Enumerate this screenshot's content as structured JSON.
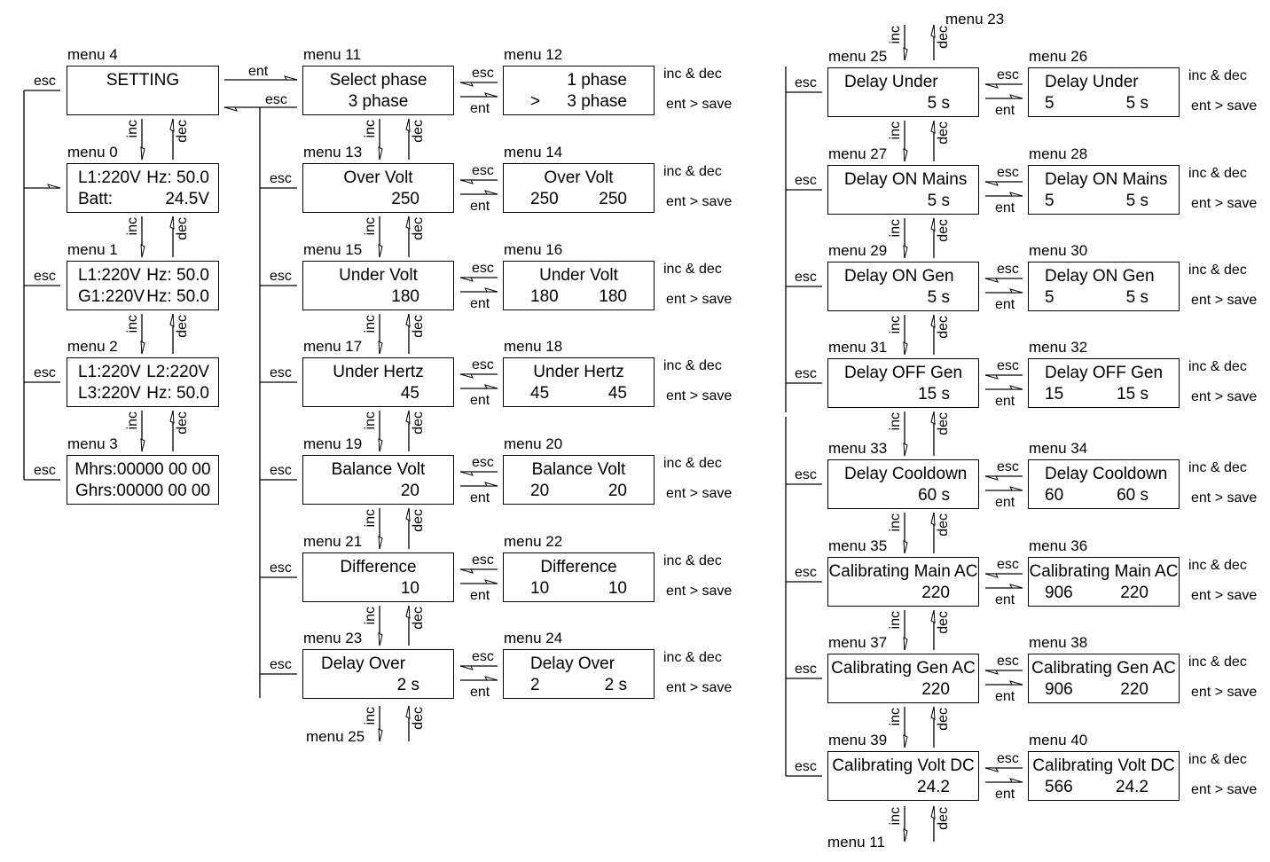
{
  "labels": {
    "esc": "esc",
    "ent": "ent",
    "inc": "inc",
    "dec": "dec",
    "note_adjust": "inc & dec",
    "note_save": "ent > save"
  },
  "columns": {
    "status": [
      {
        "title": "menu 4",
        "rows": [
          {
            "c": "SETTING"
          }
        ]
      },
      {
        "title": "menu 0",
        "rows": [
          {
            "l": "L1:220V",
            "r": "Hz: 50.0"
          },
          {
            "l": "Batt:",
            "r": "24.5V"
          }
        ]
      },
      {
        "title": "menu 1",
        "rows": [
          {
            "l": "L1:220V",
            "r": "Hz: 50.0"
          },
          {
            "l": "G1:220V",
            "r": "Hz: 50.0"
          }
        ]
      },
      {
        "title": "menu 2",
        "rows": [
          {
            "l": "L1:220V",
            "r": "L2:220V"
          },
          {
            "l": "L3:220V",
            "r": "Hz: 50.0"
          }
        ]
      },
      {
        "title": "menu 3",
        "rows": [
          {
            "c": "Mhrs:00000 00 00"
          },
          {
            "c": "Ghrs:00000 00 00"
          }
        ]
      }
    ],
    "settings_a": [
      {
        "title": "menu 11",
        "rows": [
          {
            "c": "Select phase"
          },
          {
            "c": "3 phase"
          }
        ]
      },
      {
        "title": "menu 13",
        "rows": [
          {
            "c": "Over Volt"
          },
          {
            "r": "250"
          }
        ]
      },
      {
        "title": "menu 15",
        "rows": [
          {
            "c": "Under Volt"
          },
          {
            "r": "180"
          }
        ]
      },
      {
        "title": "menu 17",
        "rows": [
          {
            "c": "Under Hertz"
          },
          {
            "r": "45"
          }
        ]
      },
      {
        "title": "menu 19",
        "rows": [
          {
            "c": "Balance Volt"
          },
          {
            "r": "20"
          }
        ]
      },
      {
        "title": "menu 21",
        "rows": [
          {
            "c": "Difference"
          },
          {
            "r": "10"
          }
        ]
      },
      {
        "title": "menu 23",
        "rows": [
          {
            "l": "Delay Over"
          },
          {
            "r": "2 s"
          }
        ]
      }
    ],
    "edit_a": [
      {
        "title": "menu 12",
        "rows": [
          {
            "r": "1 phase"
          },
          {
            "l": ">",
            "r": "3 phase"
          }
        ]
      },
      {
        "title": "menu 14",
        "rows": [
          {
            "c": "Over Volt"
          },
          {
            "l": "250",
            "r": "250"
          }
        ]
      },
      {
        "title": "menu 16",
        "rows": [
          {
            "c": "Under Volt"
          },
          {
            "l": "180",
            "r": "180"
          }
        ]
      },
      {
        "title": "menu 18",
        "rows": [
          {
            "c": "Under Hertz"
          },
          {
            "l": "45",
            "r": "45"
          }
        ]
      },
      {
        "title": "menu 20",
        "rows": [
          {
            "c": "Balance Volt"
          },
          {
            "l": "20",
            "r": "20"
          }
        ]
      },
      {
        "title": "menu 22",
        "rows": [
          {
            "c": "Difference"
          },
          {
            "l": "10",
            "r": "10"
          }
        ]
      },
      {
        "title": "menu 24",
        "rows": [
          {
            "l": "Delay Over"
          },
          {
            "l": "2",
            "r": "2 s"
          }
        ]
      }
    ],
    "settings_b": [
      {
        "title": "menu 25",
        "rows": [
          {
            "l": "Delay Under"
          },
          {
            "r": "5 s"
          }
        ]
      },
      {
        "title": "menu 27",
        "rows": [
          {
            "l": "Delay ON Mains"
          },
          {
            "r": "5 s"
          }
        ]
      },
      {
        "title": "menu 29",
        "rows": [
          {
            "l": "Delay ON Gen"
          },
          {
            "r": "5 s"
          }
        ]
      },
      {
        "title": "menu 31",
        "rows": [
          {
            "l": "Delay OFF Gen"
          },
          {
            "r": "15 s"
          }
        ]
      },
      {
        "title": "menu 33",
        "rows": [
          {
            "l": "Delay Cooldown"
          },
          {
            "r": "60 s"
          }
        ]
      },
      {
        "title": "menu 35",
        "rows": [
          {
            "c": "Calibrating Main AC"
          },
          {
            "r": "220"
          }
        ]
      },
      {
        "title": "menu 37",
        "rows": [
          {
            "c": "Calibrating Gen AC"
          },
          {
            "r": "220"
          }
        ]
      },
      {
        "title": "menu 39",
        "rows": [
          {
            "c": "Calibrating Volt DC"
          },
          {
            "r": "24.2"
          }
        ]
      }
    ],
    "edit_b": [
      {
        "title": "menu 26",
        "rows": [
          {
            "l": "Delay Under"
          },
          {
            "l": "5",
            "r": "5 s"
          }
        ]
      },
      {
        "title": "menu 28",
        "rows": [
          {
            "l": "Delay ON Mains"
          },
          {
            "l": "5",
            "r": "5 s"
          }
        ]
      },
      {
        "title": "menu 30",
        "rows": [
          {
            "l": "Delay ON Gen"
          },
          {
            "l": "5",
            "r": "5 s"
          }
        ]
      },
      {
        "title": "menu 32",
        "rows": [
          {
            "l": "Delay OFF Gen"
          },
          {
            "l": "15",
            "r": "15 s"
          }
        ]
      },
      {
        "title": "menu 34",
        "rows": [
          {
            "l": "Delay Cooldown"
          },
          {
            "l": "60",
            "r": "60 s"
          }
        ]
      },
      {
        "title": "menu 36",
        "rows": [
          {
            "c": "Calibrating Main AC"
          },
          {
            "l": "906",
            "r": "220"
          }
        ]
      },
      {
        "title": "menu 38",
        "rows": [
          {
            "c": "Calibrating Gen AC"
          },
          {
            "l": "906",
            "r": "220"
          }
        ]
      },
      {
        "title": "menu 40",
        "rows": [
          {
            "c": "Calibrating Volt DC"
          },
          {
            "l": "566",
            "r": "24.2"
          }
        ]
      }
    ]
  },
  "continuations": {
    "settings_a_next": "menu 25",
    "settings_b_prev": "menu 23",
    "settings_b_next": "menu 11"
  }
}
